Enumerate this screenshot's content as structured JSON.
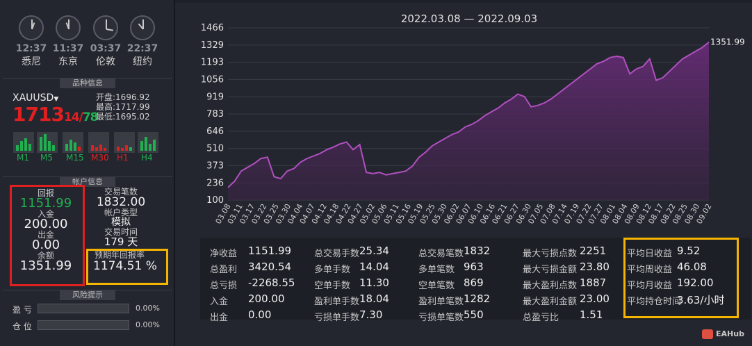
{
  "clocks": [
    {
      "time": "12:37",
      "city": "悉尼",
      "h": 0.1,
      "m": 6.2
    },
    {
      "time": "11:37",
      "city": "东京",
      "h": -0.4,
      "m": 6.2
    },
    {
      "time": "03:37",
      "city": "伦敦",
      "h": 1.7,
      "m": 6.2
    },
    {
      "time": "22:37",
      "city": "纽约",
      "h": -1.2,
      "m": 6.2
    }
  ],
  "sections": {
    "instrument": "品种信息",
    "account": "帐户信息",
    "risk": "风险提示"
  },
  "instrument": {
    "symbol": "XAUUSD",
    "price_main": "1713",
    "price_frac_a": "14",
    "price_frac_sep": "/",
    "price_frac_b": "78",
    "open_label": "开盘:",
    "open": "1696.92",
    "high_label": "最高:",
    "high": "1717.99",
    "low_label": "最低:",
    "low": "1695.02",
    "timeframes": [
      "M1",
      "M5",
      "M15",
      "M30",
      "H1",
      "H4"
    ]
  },
  "account": {
    "return_label": "回报",
    "return_value": "1151.99",
    "deposit_label": "入金",
    "deposit_value": "200.00",
    "withdraw_label": "出金",
    "withdraw_value": "0.00",
    "balance_label": "余额",
    "balance_value": "1351.99",
    "trades_label": "交易笔数",
    "trades_value": "1832.00",
    "type_label": "帐户类型",
    "type_value": "模拟",
    "time_label": "交易时间",
    "time_value": "179 天",
    "annual_label": "预期年回报率",
    "annual_value": "1174.51 %"
  },
  "risk": [
    {
      "label": "盈 亏",
      "value": "0.00%",
      "fill": 0
    },
    {
      "label": "仓 位",
      "value": "0.00%",
      "fill": 0
    }
  ],
  "chart_data": {
    "type": "area",
    "title": "2022.03.08 — 2022.09.03",
    "y_ticks": [
      100,
      236,
      373,
      510,
      646,
      783,
      919,
      1056,
      1193,
      1329,
      1466
    ],
    "ylim": [
      100,
      1466
    ],
    "last_value_label": "1351.99",
    "x_ticks": [
      "03.08",
      "03.11",
      "03.17",
      "03.22",
      "03.25",
      "03.30",
      "04.04",
      "04.07",
      "04.12",
      "04.18",
      "04.22",
      "04.27",
      "05.02",
      "05.06",
      "05.11",
      "05.16",
      "05.19",
      "05.25",
      "05.30",
      "06.02",
      "06.07",
      "06.10",
      "06.16",
      "06.21",
      "06.27",
      "06.30",
      "07.05",
      "07.08",
      "07.14",
      "07.19",
      "07.22",
      "07.27",
      "08.01",
      "08.04",
      "08.09",
      "08.12",
      "08.17",
      "08.22",
      "08.25",
      "08.30",
      "09.02"
    ],
    "values": [
      200,
      250,
      330,
      360,
      390,
      430,
      440,
      285,
      270,
      330,
      350,
      400,
      430,
      450,
      470,
      500,
      520,
      545,
      560,
      500,
      540,
      320,
      310,
      320,
      300,
      310,
      320,
      330,
      370,
      440,
      480,
      530,
      560,
      590,
      620,
      640,
      680,
      700,
      730,
      770,
      800,
      830,
      870,
      900,
      940,
      920,
      840,
      850,
      870,
      900,
      940,
      980,
      1020,
      1060,
      1100,
      1140,
      1180,
      1200,
      1230,
      1240,
      1230,
      1100,
      1140,
      1160,
      1220,
      1050,
      1070,
      1120,
      1170,
      1220,
      1250,
      1280,
      1310,
      1351.99
    ],
    "color": "#a050b0"
  },
  "stats": [
    [
      {
        "label": "净收益",
        "value": "1151.99"
      },
      {
        "label": "总盈利",
        "value": "3420.54"
      },
      {
        "label": "总亏损",
        "value": "-2268.55"
      },
      {
        "label": "入金",
        "value": "200.00"
      },
      {
        "label": "出金",
        "value": "0.00"
      }
    ],
    [
      {
        "label": "总交易手数",
        "value": "25.34"
      },
      {
        "label": "多单手数",
        "value": "14.04"
      },
      {
        "label": "空单手数",
        "value": "11.30"
      },
      {
        "label": "盈利单手数",
        "value": "18.04"
      },
      {
        "label": "亏损单手数",
        "value": "7.30"
      }
    ],
    [
      {
        "label": "总交易笔数",
        "value": "1832"
      },
      {
        "label": "多单笔数",
        "value": "963"
      },
      {
        "label": "空单笔数",
        "value": "869"
      },
      {
        "label": "盈利单笔数",
        "value": "1282"
      },
      {
        "label": "亏损单笔数",
        "value": "550"
      }
    ],
    [
      {
        "label": "最大亏损点数",
        "value": "2251"
      },
      {
        "label": "最大亏损金额",
        "value": "23.80"
      },
      {
        "label": "最大盈利点数",
        "value": "1887"
      },
      {
        "label": "最大盈利金额",
        "value": "23.00"
      },
      {
        "label": "总盈亏比",
        "value": "1.51"
      }
    ],
    [
      {
        "label": "平均日收益",
        "value": "9.52"
      },
      {
        "label": "平均周收益",
        "value": "46.08"
      },
      {
        "label": "平均月收益",
        "value": "192.00"
      },
      {
        "label": "平均持仓时间",
        "value": "3.63/小时"
      }
    ]
  ],
  "watermark": "EAHub",
  "colors": {
    "highlight_red": "#e02020",
    "highlight_orange": "#f5b400",
    "up": "#20b050",
    "down": "#e02020"
  }
}
